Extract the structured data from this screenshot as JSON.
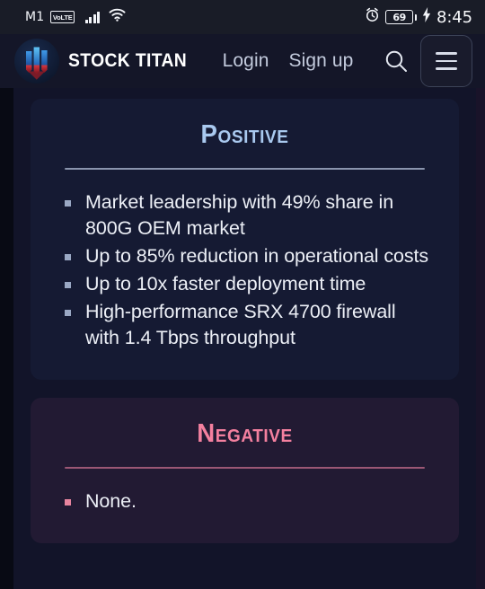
{
  "status_bar": {
    "carrier": "M1",
    "volte_label": "VoLTE",
    "signal_icon": "signal-bars-icon",
    "wifi_icon": "wifi-icon",
    "alarm_icon": "alarm-clock-icon",
    "battery_level": "69",
    "charging_icon": "charging-bolt-icon",
    "time": "8:45"
  },
  "header": {
    "logo_icon": "stock-titan-logo-icon",
    "brand_name": "STOCK TITAN",
    "login_label": "Login",
    "signup_label": "Sign up",
    "search_icon": "search-icon",
    "menu_icon": "hamburger-menu-icon"
  },
  "cards": {
    "positive": {
      "title": "Positive",
      "accent_color": "#a9c9ef",
      "background_color": "#151a33",
      "bullets": [
        "Market leadership with 49% share in 800G OEM market",
        "Up to 85% reduction in operational costs",
        "Up to 10x faster deployment time",
        "High-performance SRX 4700 firewall with 1.4 Tbps throughput"
      ]
    },
    "negative": {
      "title": "Negative",
      "accent_color": "#f4809f",
      "background_color": "#221a33",
      "bullets": [
        "None."
      ]
    }
  }
}
